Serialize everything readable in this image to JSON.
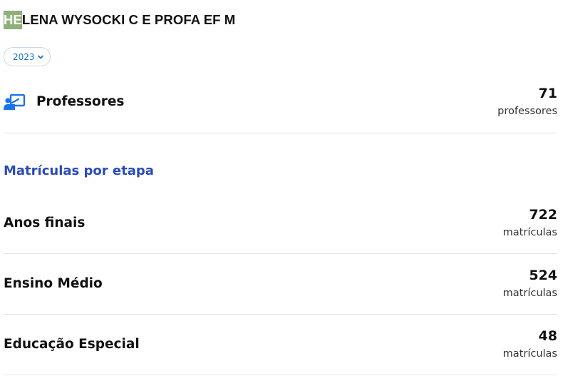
{
  "school": {
    "name_highlight": "HE",
    "name_rest": "LENA WYSOCKI C E PROFA EF M",
    "highlight_color": "#8fb07a"
  },
  "year_select": {
    "selected": "2023",
    "icon": "chevron-down-icon"
  },
  "professores": {
    "label": "Professores",
    "value": "71",
    "unit": "professores",
    "icon": "teacher-board-icon",
    "icon_color": "#1a73e8"
  },
  "matriculas": {
    "section_title": "Matrículas por etapa",
    "title_color": "#2a4ab8",
    "stages": [
      {
        "label": "Anos finais",
        "value": "722",
        "unit": "matrículas"
      },
      {
        "label": "Ensino Médio",
        "value": "524",
        "unit": "matrículas"
      },
      {
        "label": "Educação Especial",
        "value": "48",
        "unit": "matrículas"
      }
    ]
  }
}
